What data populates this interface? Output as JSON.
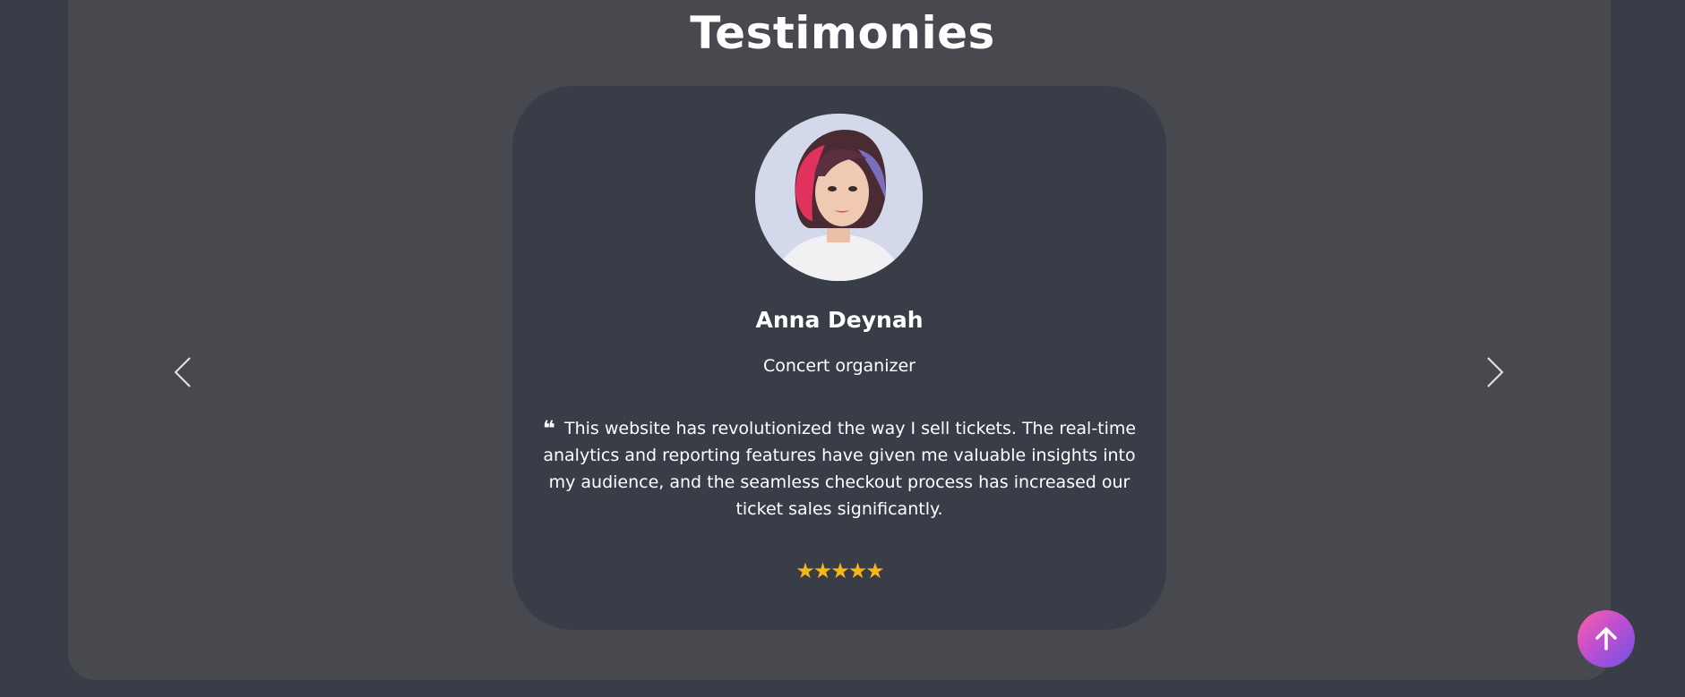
{
  "section": {
    "title": "Testimonies"
  },
  "testimonial": {
    "name": "Anna Deynah",
    "role": "Concert organizer",
    "quote": "This website has revolutionized the way I sell tickets. The real-time analytics and reporting features have given me valuable insights into my audience, and the seamless checkout process has increased our ticket sales significantly.",
    "quote_icon": "❝",
    "rating_stars": "★★★★★",
    "rating": 5
  },
  "icons": {
    "prev": "chevron-left-icon",
    "next": "chevron-right-icon",
    "scroll_top": "arrow-up-icon",
    "quote": "quote-icon",
    "star": "star-icon"
  },
  "colors": {
    "background": "#393d47",
    "section_bg": "#47494f",
    "card_bg": "#393d47",
    "star": "#f5b61a",
    "scroll_button_gradient": [
      "#ff5ea8",
      "#c04fcf",
      "#6c52e8"
    ]
  }
}
